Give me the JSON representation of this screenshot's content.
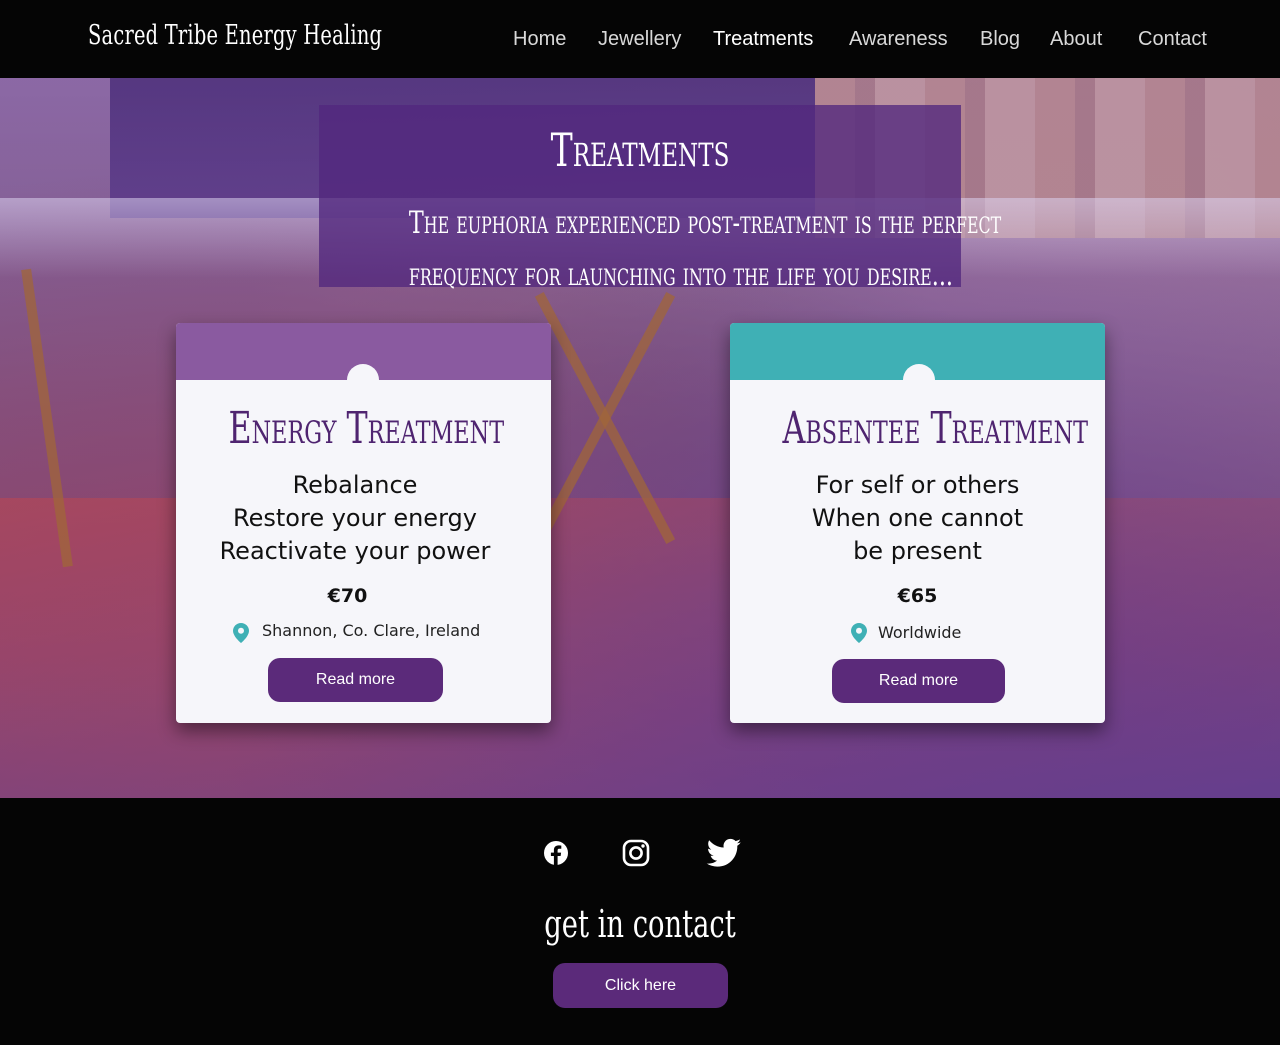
{
  "header": {
    "brand": "Sacred Tribe Energy Healing",
    "nav": [
      {
        "label": "Home"
      },
      {
        "label": "Jewellery"
      },
      {
        "label": "Treatments",
        "active": true
      },
      {
        "label": "Awareness"
      },
      {
        "label": "Blog"
      },
      {
        "label": "About"
      },
      {
        "label": "Contact"
      }
    ]
  },
  "hero": {
    "title": "Treatments",
    "tagline_line1": "The euphoria experienced post-treatment is the perfect",
    "tagline_line2": "frequency for launching into the life you desire..."
  },
  "cards": [
    {
      "title": "Energy Treatment",
      "lines": [
        "Rebalance",
        "Restore your energy",
        "Reactivate your power"
      ],
      "price": "€70",
      "location": "Shannon, Co. Clare, Ireland",
      "button": "Read more",
      "accent": "#8a5aa0"
    },
    {
      "title": "Absentee Treatment",
      "lines": [
        "For self or others",
        "When one cannot",
        "be present"
      ],
      "price": "€65",
      "location": "Worldwide",
      "button": "Read more",
      "accent": "#3fb0b5"
    }
  ],
  "footer": {
    "social": [
      "facebook-icon",
      "instagram-icon",
      "twitter-icon"
    ],
    "heading": "get in contact",
    "button": "Click here"
  },
  "colors": {
    "brand_purple": "#5b2a7a",
    "title_purple": "#4f2470",
    "teal": "#3fb0b5",
    "pin_teal": "#3fb0b5",
    "header_bg": "#050505"
  }
}
